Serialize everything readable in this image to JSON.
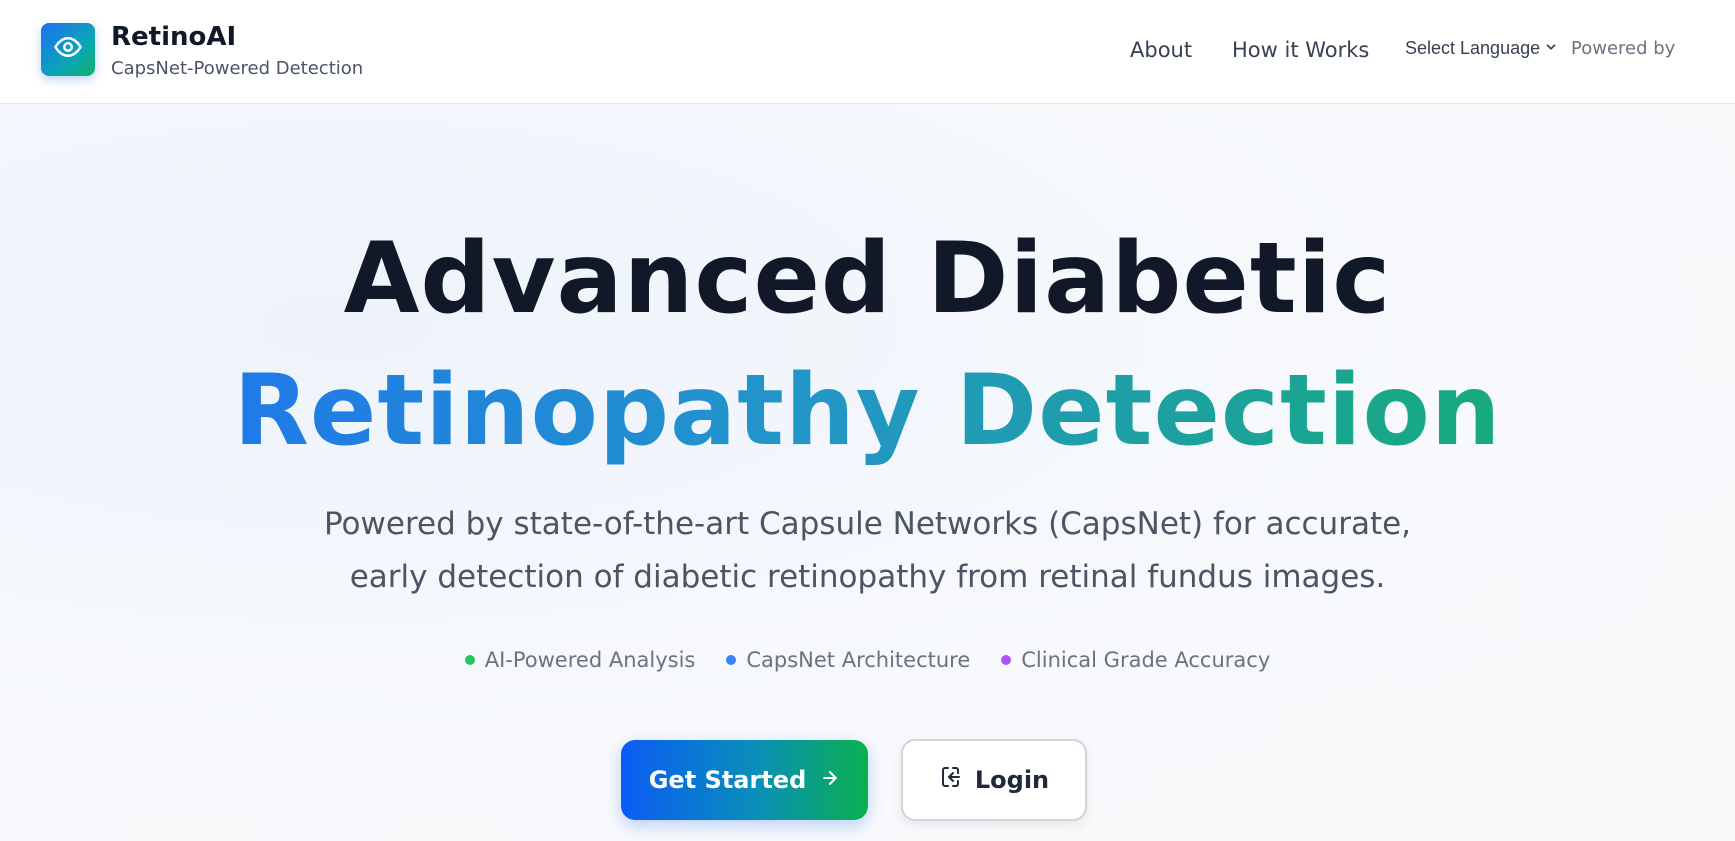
{
  "header": {
    "brand_name": "RetinoAI",
    "brand_subtitle": "CapsNet-Powered Detection",
    "logo_icon": "eye-icon",
    "nav": {
      "about": "About",
      "how_it_works": "How it Works",
      "language_select": "Select Language",
      "powered_by": "Powered by"
    }
  },
  "hero": {
    "headline_line1": "Advanced Diabetic",
    "headline_line2": "Retinopathy Detection",
    "description": "Powered by state-of-the-art Capsule Networks (CapsNet) for accurate, early detection of diabetic retinopathy from retinal fundus images.",
    "features": [
      {
        "label": "AI-Powered Analysis",
        "dot_color": "#22c55e"
      },
      {
        "label": "CapsNet Architecture",
        "dot_color": "#3b82f6"
      },
      {
        "label": "Clinical Grade Accuracy",
        "dot_color": "#a855f7"
      }
    ],
    "buttons": {
      "get_started": "Get Started",
      "get_started_icon": "arrow-right-icon",
      "login": "Login",
      "login_icon": "login-icon"
    }
  },
  "colors": {
    "brand_blue": "#0b5cf5",
    "brand_teal": "#0a8fb8",
    "brand_green": "#0bb04f",
    "heading_dark": "#111827"
  }
}
